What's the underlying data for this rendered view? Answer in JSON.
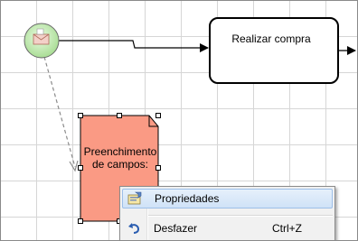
{
  "diagram": {
    "task_label": "Realizar compra",
    "note_label_line1": "Preenchimento",
    "note_label_line2": "de campos:"
  },
  "context_menu": {
    "items": [
      {
        "label": "Propriedades",
        "shortcut": "",
        "icon": "properties-icon",
        "highlighted": true
      },
      {
        "label": "Desfazer",
        "shortcut": "Ctrl+Z",
        "icon": "undo-icon",
        "highlighted": false
      }
    ]
  },
  "colors": {
    "note_fill": "#fa9a84",
    "start_event_fill": "#c8edb9",
    "menu_highlight": "#cfe2f7"
  }
}
